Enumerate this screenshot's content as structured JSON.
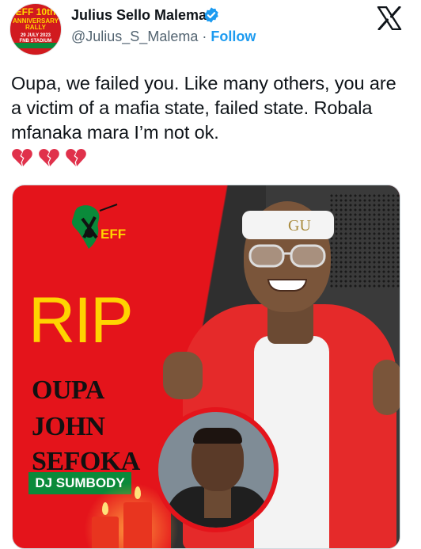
{
  "author": {
    "name": "Julius Sello Malema",
    "handle": "@Julius_S_Malema",
    "separator": "·",
    "follow_label": "Follow",
    "verified_icon": "verified-badge-icon",
    "avatar_text": [
      "EFF 10th",
      "ANNIVERSARY",
      "RALLY",
      "29 JULY 2023",
      "FNB STADIUM"
    ]
  },
  "platform_icon": "x-logo-icon",
  "tweet": {
    "text": "Oupa, we failed you. Like many others, you are a victim of a mafia state, failed state.  Robala mfanaka mara I’m not ok.",
    "emoji": [
      "broken-heart-icon",
      "broken-heart-icon",
      "broken-heart-icon"
    ]
  },
  "media": {
    "logo_text": "EFF",
    "headline": "RIP",
    "name_lines": [
      "OUPA",
      "JOHN",
      "SEFOKA"
    ],
    "badge": "DJ SUMBODY",
    "headband_text": "GU"
  },
  "colors": {
    "accent": "#1d9bf0",
    "eff_red": "#e4141b",
    "eff_yellow": "#ffd400",
    "eff_green": "#0a8a3a"
  }
}
